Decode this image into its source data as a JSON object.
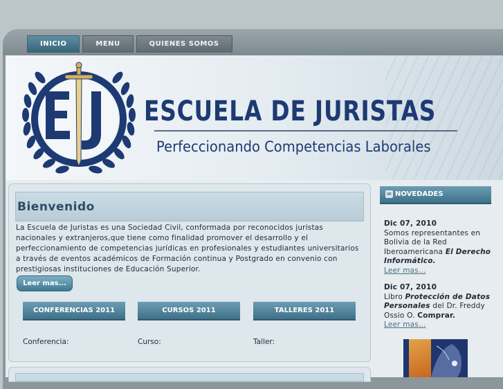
{
  "nav": {
    "tabs": [
      {
        "label": "INICIO"
      },
      {
        "label": "MENU"
      },
      {
        "label": "QUIENES SOMOS"
      }
    ]
  },
  "banner": {
    "logo_letters": "EJ",
    "title": "ESCUELA DE JURISTAS",
    "subtitle": "Perfeccionando Competencias Laborales"
  },
  "welcome": {
    "title": "Bienvenido",
    "body": "La Escuela de Juristas es una Sociedad Civil, conformada por reconocidos juristas nacionales y extranjeros,que tiene como finalidad promover el desarrollo y el perfeccionamiento de competencias jurídicas en profesionales y estudiantes universitarios a través de eventos académicos de Formación continua y Postgrado en convenio con prestigiosas instituciones de Educación Superior.",
    "read_more": "Leer mas..."
  },
  "categories": [
    {
      "label": "CONFERENCIAS 2011",
      "caption": "Conferencia:"
    },
    {
      "label": "CURSOS 2011",
      "caption": "Curso:"
    },
    {
      "label": "TALLERES 2011",
      "caption": "Taller:"
    }
  ],
  "sidebar": {
    "title": "NOVEDADES",
    "news": [
      {
        "date": "Dic 07, 2010",
        "text": "Somos representantes en Bolivia de la Red Iberoamericana",
        "emphasis": "El Derecho Informático.",
        "link": "Leer mas..."
      },
      {
        "date": "Dic 07, 2010",
        "prefix": "Libro",
        "emphasis": "Protección de Datos Personales",
        "text": "del Dr. Freddy Ossio O.",
        "strong": "Comprar.",
        "link": "Leer mas..."
      }
    ]
  },
  "colors": {
    "brand_navy": "#1d3a72",
    "accent_blue": "#3d7189",
    "gold": "#d8b15a"
  }
}
